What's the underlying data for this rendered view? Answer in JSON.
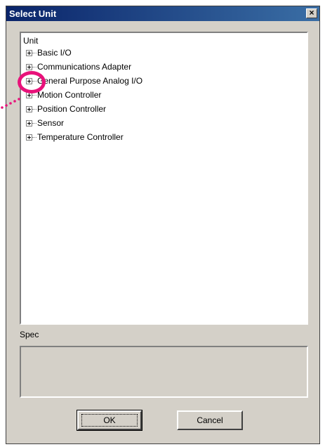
{
  "dialog": {
    "title": "Select Unit",
    "close_label": "×"
  },
  "tree": {
    "root_label": "Unit",
    "items": [
      {
        "label": "Basic I/O"
      },
      {
        "label": "Communications Adapter"
      },
      {
        "label": "General Purpose Analog I/O"
      },
      {
        "label": "Motion Controller"
      },
      {
        "label": "Position Controller"
      },
      {
        "label": "Sensor"
      },
      {
        "label": "Temperature Controller"
      }
    ]
  },
  "spec": {
    "label": "Spec",
    "value": ""
  },
  "buttons": {
    "ok_label": "OK",
    "cancel_label": "Cancel"
  },
  "annotation": {
    "ring_color": "#e8127a"
  }
}
